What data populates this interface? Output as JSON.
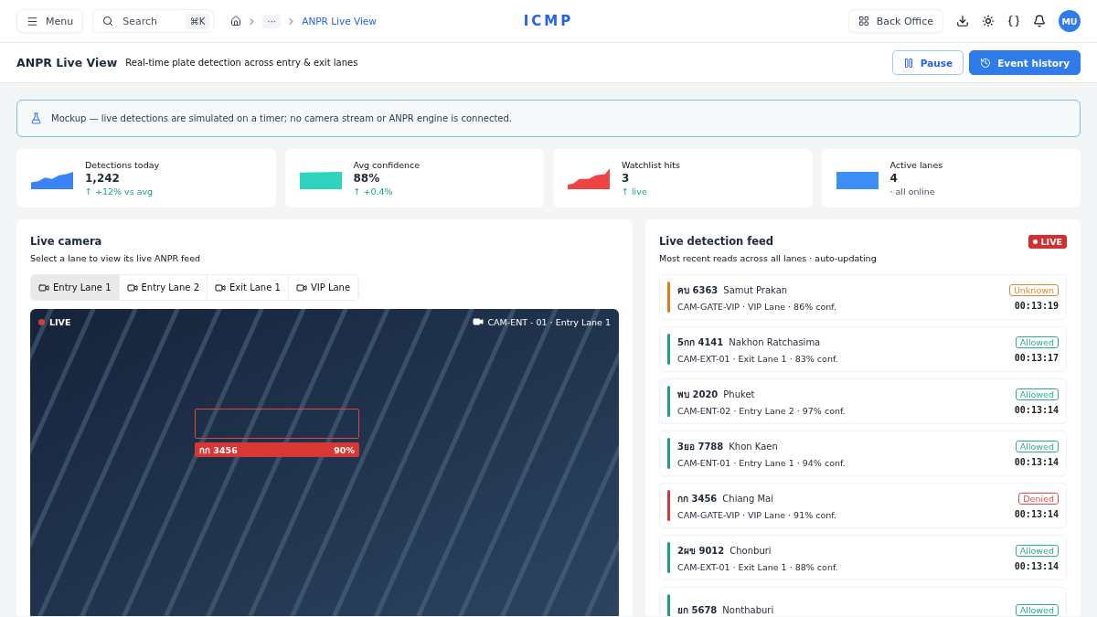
{
  "topbar": {
    "menu": "Menu",
    "search": {
      "placeholder": "Search",
      "shortcut": "⌘K"
    },
    "breadcrumb": {
      "ellipsis": "···",
      "current": "ANPR Live View"
    },
    "logo": "ICMP",
    "back_office": "Back Office",
    "avatar": "MU"
  },
  "page": {
    "title": "ANPR Live View",
    "subtitle": "Real-time plate detection across entry & exit lanes",
    "buttons": [
      {
        "label": "Pause",
        "kind": "outline"
      },
      {
        "label": "Event history",
        "kind": "primary"
      }
    ]
  },
  "banner": "Mockup — live detections are simulated on a timer; no camera stream or ANPR engine is connected.",
  "kpis": [
    {
      "label": "Detections today",
      "value": "1,242",
      "delta": "↑ +12% vs avg",
      "positive": true,
      "kind": "rising",
      "color": "#3b82f6"
    },
    {
      "label": "Avg confidence",
      "value": "88%",
      "delta": "↑ +0.4%",
      "positive": true,
      "kind": "flat",
      "color": "#2dd4bf"
    },
    {
      "label": "Watchlist hits",
      "value": "3",
      "delta": "↑ live",
      "positive": true,
      "kind": "step",
      "color": "#ef4444"
    },
    {
      "label": "Active lanes",
      "value": "4",
      "delta": "· all online",
      "positive": false,
      "kind": "block",
      "color": "#3b8ff6"
    }
  ],
  "camera": {
    "title": "Live camera",
    "subtitle": "Select a lane to view its live ANPR feed",
    "tabs": [
      {
        "label": "Entry Lane 1",
        "selected": true
      },
      {
        "label": "Entry Lane 2",
        "selected": false
      },
      {
        "label": "Exit Lane 1",
        "selected": false
      },
      {
        "label": "VIP Lane",
        "selected": false
      }
    ],
    "live": "LIVE",
    "source": "CAM-ENT - 01 · Entry Lane 1",
    "detection": {
      "plate": "กก 3456",
      "confidence": "90%"
    }
  },
  "feed": {
    "title": "Live detection feed",
    "subtitle": "Most recent reads across all lanes · auto-updating",
    "badge": "LIVE",
    "items": [
      {
        "plate": "คบ 6363",
        "city": "Samut Prakan",
        "meta": "CAM-GATE-VIP · VIP Lane · 86% conf.",
        "status": "Unknown",
        "kind": "unknown",
        "time": "00:13:19"
      },
      {
        "plate": "5กก 4141",
        "city": "Nakhon Ratchasima",
        "meta": "CAM-EXT-01 · Exit Lane 1 · 83% conf.",
        "status": "Allowed",
        "kind": "allowed",
        "time": "00:13:17"
      },
      {
        "plate": "พบ 2020",
        "city": "Phuket",
        "meta": "CAM-ENT-02 · Entry Lane 2 · 97% conf.",
        "status": "Allowed",
        "kind": "allowed",
        "time": "00:13:14"
      },
      {
        "plate": "3ยอ 7788",
        "city": "Khon Kaen",
        "meta": "CAM-ENT-01 · Entry Lane 1 · 94% conf.",
        "status": "Allowed",
        "kind": "allowed",
        "time": "00:13:14"
      },
      {
        "plate": "กก 3456",
        "city": "Chiang Mai",
        "meta": "CAM-GATE-VIP · VIP Lane · 91% conf.",
        "status": "Denied",
        "kind": "denied",
        "time": "00:13:14"
      },
      {
        "plate": "2ผข 9012",
        "city": "Chonburi",
        "meta": "CAM-EXT-01 · Exit Lane 1 · 88% conf.",
        "status": "Allowed",
        "kind": "allowed",
        "time": "00:13:14"
      },
      {
        "plate": "ยก 5678",
        "city": "Nonthaburi",
        "status": "Allowed",
        "kind": "allowed"
      }
    ]
  }
}
